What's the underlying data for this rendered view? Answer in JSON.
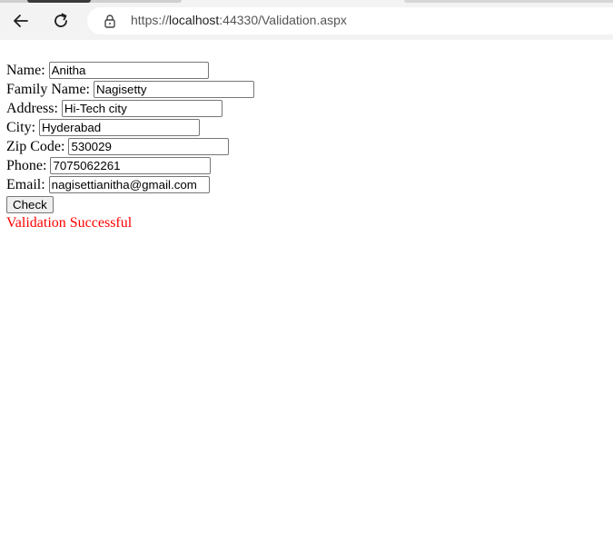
{
  "browser": {
    "url_prefix": "https://",
    "url_host": "localhost",
    "url_rest": ":44330/Validation.aspx"
  },
  "form": {
    "fields": [
      {
        "label": "Name:",
        "value": "Anitha"
      },
      {
        "label": "Family Name:",
        "value": "Nagisetty"
      },
      {
        "label": "Address:",
        "value": "Hi-Tech city"
      },
      {
        "label": "City:",
        "value": "Hyderabad"
      },
      {
        "label": "Zip Code:",
        "value": "530029"
      },
      {
        "label": "Phone:",
        "value": "7075062261"
      },
      {
        "label": "Email:",
        "value": "nagisettianitha@gmail.com"
      }
    ],
    "check_label": "Check",
    "result": "Validation Successful",
    "result_color": "#ff0000"
  }
}
